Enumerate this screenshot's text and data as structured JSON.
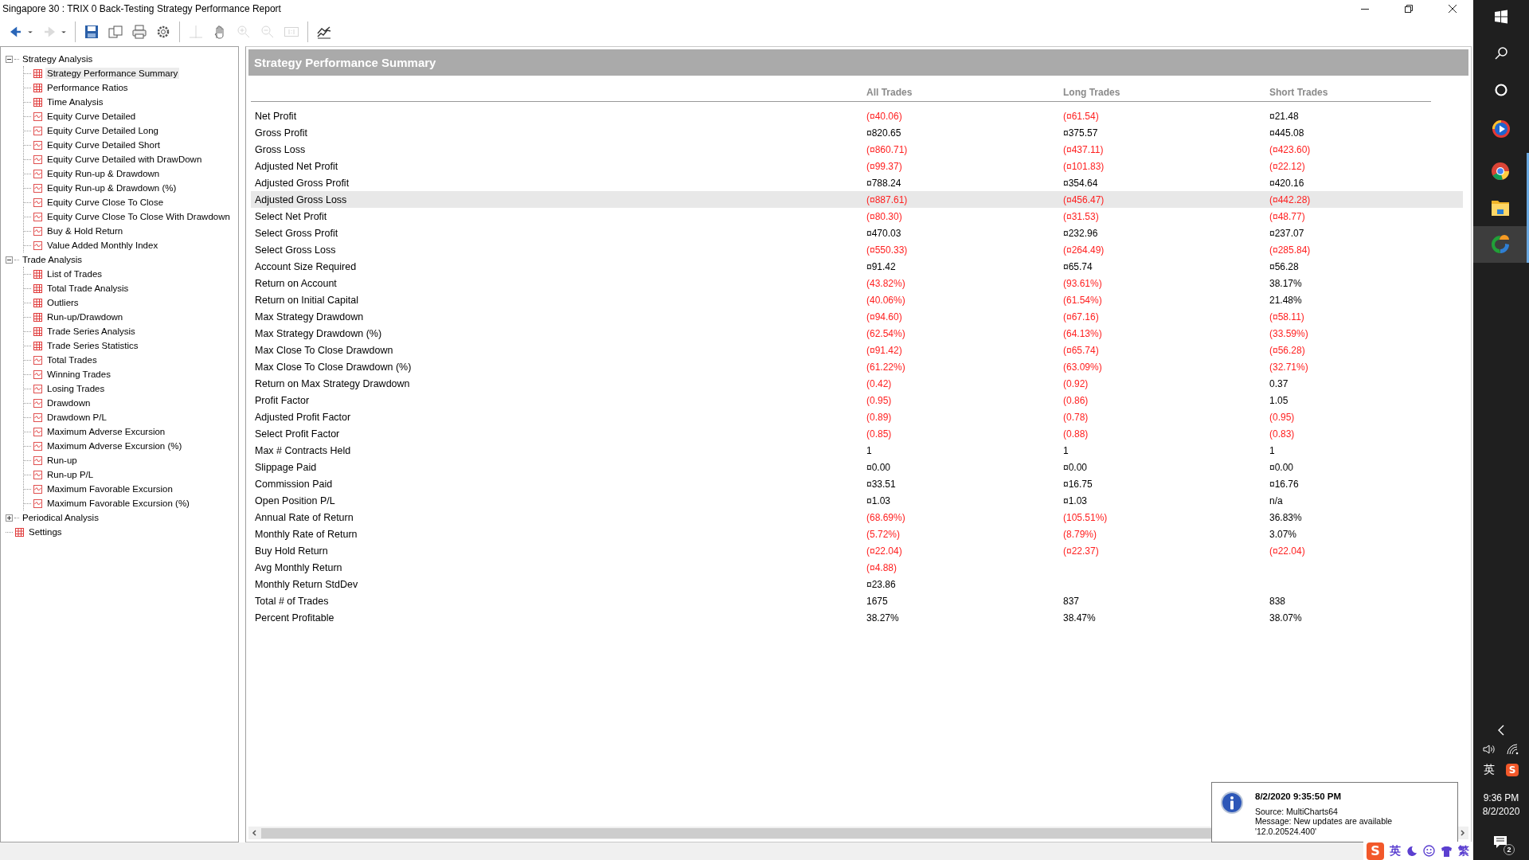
{
  "window": {
    "title": "Singapore 30 : TRIX 0 Back-Testing Strategy Performance Report"
  },
  "toolbar": [
    {
      "kind": "back",
      "disabled": false
    },
    {
      "kind": "caret",
      "disabled": false
    },
    {
      "kind": "forward",
      "disabled": true
    },
    {
      "kind": "caret",
      "disabled": false
    },
    {
      "kind": "sep"
    },
    {
      "kind": "save",
      "disabled": false
    },
    {
      "kind": "pages",
      "disabled": false
    },
    {
      "kind": "print",
      "disabled": false
    },
    {
      "kind": "gear",
      "disabled": false
    },
    {
      "kind": "sep"
    },
    {
      "kind": "cross",
      "disabled": true
    },
    {
      "kind": "hand",
      "disabled": false
    },
    {
      "kind": "zoomin",
      "disabled": true
    },
    {
      "kind": "zoomout",
      "disabled": true
    },
    {
      "kind": "fit",
      "disabled": true
    },
    {
      "kind": "sep"
    },
    {
      "kind": "chart",
      "disabled": false
    }
  ],
  "tree": [
    {
      "label": "Strategy Analysis",
      "kind": "group",
      "expanded": true,
      "selected": false,
      "children": [
        {
          "label": "Strategy Performance Summary",
          "kind": "table",
          "selected": true
        },
        {
          "label": "Performance Ratios",
          "kind": "table",
          "selected": false
        },
        {
          "label": "Time Analysis",
          "kind": "table",
          "selected": false
        },
        {
          "label": "Equity Curve Detailed",
          "kind": "chart",
          "selected": false
        },
        {
          "label": "Equity Curve Detailed Long",
          "kind": "chart",
          "selected": false
        },
        {
          "label": "Equity Curve Detailed Short",
          "kind": "chart",
          "selected": false
        },
        {
          "label": "Equity Curve Detailed with DrawDown",
          "kind": "chart",
          "selected": false
        },
        {
          "label": "Equity Run-up & Drawdown",
          "kind": "chart",
          "selected": false
        },
        {
          "label": "Equity Run-up & Drawdown (%)",
          "kind": "chart",
          "selected": false
        },
        {
          "label": "Equity Curve Close To Close",
          "kind": "chart",
          "selected": false
        },
        {
          "label": "Equity Curve Close To Close With Drawdown",
          "kind": "chart",
          "selected": false
        },
        {
          "label": "Buy & Hold Return",
          "kind": "chart",
          "selected": false
        },
        {
          "label": "Value Added Monthly Index",
          "kind": "chart",
          "selected": false
        }
      ]
    },
    {
      "label": "Trade Analysis",
      "kind": "group",
      "expanded": true,
      "selected": false,
      "children": [
        {
          "label": "List of Trades",
          "kind": "table",
          "selected": false
        },
        {
          "label": "Total Trade Analysis",
          "kind": "table",
          "selected": false
        },
        {
          "label": "Outliers",
          "kind": "table",
          "selected": false
        },
        {
          "label": "Run-up/Drawdown",
          "kind": "table",
          "selected": false
        },
        {
          "label": "Trade Series Analysis",
          "kind": "table",
          "selected": false
        },
        {
          "label": "Trade Series Statistics",
          "kind": "table",
          "selected": false
        },
        {
          "label": "Total Trades",
          "kind": "chart",
          "selected": false
        },
        {
          "label": "Winning Trades",
          "kind": "chart",
          "selected": false
        },
        {
          "label": "Losing Trades",
          "kind": "chart",
          "selected": false
        },
        {
          "label": "Drawdown",
          "kind": "chart",
          "selected": false
        },
        {
          "label": "Drawdown P/L",
          "kind": "chart",
          "selected": false
        },
        {
          "label": "Maximum Adverse Excursion",
          "kind": "chart",
          "selected": false
        },
        {
          "label": "Maximum Adverse Excursion (%)",
          "kind": "chart",
          "selected": false
        },
        {
          "label": "Run-up",
          "kind": "chart",
          "selected": false
        },
        {
          "label": "Run-up P/L",
          "kind": "chart",
          "selected": false
        },
        {
          "label": "Maximum Favorable Excursion",
          "kind": "chart",
          "selected": false
        },
        {
          "label": "Maximum Favorable Excursion (%)",
          "kind": "chart",
          "selected": false
        }
      ]
    },
    {
      "label": "Periodical Analysis",
      "kind": "group",
      "expanded": false,
      "selected": false
    },
    {
      "label": "Settings",
      "kind": "table",
      "selected": false
    }
  ],
  "report": {
    "title": "Strategy Performance Summary",
    "columns": [
      "All Trades",
      "Long Trades",
      "Short Trades"
    ],
    "rows": [
      {
        "label": "Net Profit",
        "selected": false,
        "values": [
          {
            "text": "(¤40.06)",
            "negative": true
          },
          {
            "text": "(¤61.54)",
            "negative": true
          },
          {
            "text": "¤21.48",
            "negative": false
          }
        ]
      },
      {
        "label": "Gross Profit",
        "selected": false,
        "values": [
          {
            "text": "¤820.65",
            "negative": false
          },
          {
            "text": "¤375.57",
            "negative": false
          },
          {
            "text": "¤445.08",
            "negative": false
          }
        ]
      },
      {
        "label": "Gross Loss",
        "selected": false,
        "values": [
          {
            "text": "(¤860.71)",
            "negative": true
          },
          {
            "text": "(¤437.11)",
            "negative": true
          },
          {
            "text": "(¤423.60)",
            "negative": true
          }
        ]
      },
      {
        "label": "Adjusted Net Profit",
        "selected": false,
        "values": [
          {
            "text": "(¤99.37)",
            "negative": true
          },
          {
            "text": "(¤101.83)",
            "negative": true
          },
          {
            "text": "(¤22.12)",
            "negative": true
          }
        ]
      },
      {
        "label": "Adjusted Gross Profit",
        "selected": false,
        "values": [
          {
            "text": "¤788.24",
            "negative": false
          },
          {
            "text": "¤354.64",
            "negative": false
          },
          {
            "text": "¤420.16",
            "negative": false
          }
        ]
      },
      {
        "label": "Adjusted Gross Loss",
        "selected": true,
        "values": [
          {
            "text": "(¤887.61)",
            "negative": true
          },
          {
            "text": "(¤456.47)",
            "negative": true
          },
          {
            "text": "(¤442.28)",
            "negative": true
          }
        ]
      },
      {
        "label": "Select Net Profit",
        "selected": false,
        "values": [
          {
            "text": "(¤80.30)",
            "negative": true
          },
          {
            "text": "(¤31.53)",
            "negative": true
          },
          {
            "text": "(¤48.77)",
            "negative": true
          }
        ]
      },
      {
        "label": "Select Gross Profit",
        "selected": false,
        "values": [
          {
            "text": "¤470.03",
            "negative": false
          },
          {
            "text": "¤232.96",
            "negative": false
          },
          {
            "text": "¤237.07",
            "negative": false
          }
        ]
      },
      {
        "label": "Select Gross Loss",
        "selected": false,
        "values": [
          {
            "text": "(¤550.33)",
            "negative": true
          },
          {
            "text": "(¤264.49)",
            "negative": true
          },
          {
            "text": "(¤285.84)",
            "negative": true
          }
        ]
      },
      {
        "label": "Account Size Required",
        "selected": false,
        "values": [
          {
            "text": "¤91.42",
            "negative": false
          },
          {
            "text": "¤65.74",
            "negative": false
          },
          {
            "text": "¤56.28",
            "negative": false
          }
        ]
      },
      {
        "label": "Return on Account",
        "selected": false,
        "values": [
          {
            "text": "(43.82%)",
            "negative": true
          },
          {
            "text": "(93.61%)",
            "negative": true
          },
          {
            "text": "38.17%",
            "negative": false
          }
        ]
      },
      {
        "label": "Return on Initial Capital",
        "selected": false,
        "values": [
          {
            "text": "(40.06%)",
            "negative": true
          },
          {
            "text": "(61.54%)",
            "negative": true
          },
          {
            "text": "21.48%",
            "negative": false
          }
        ]
      },
      {
        "label": "Max Strategy Drawdown",
        "selected": false,
        "values": [
          {
            "text": "(¤94.60)",
            "negative": true
          },
          {
            "text": "(¤67.16)",
            "negative": true
          },
          {
            "text": "(¤58.11)",
            "negative": true
          }
        ]
      },
      {
        "label": "Max Strategy Drawdown (%)",
        "selected": false,
        "values": [
          {
            "text": "(62.54%)",
            "negative": true
          },
          {
            "text": "(64.13%)",
            "negative": true
          },
          {
            "text": "(33.59%)",
            "negative": true
          }
        ]
      },
      {
        "label": "Max Close To Close Drawdown",
        "selected": false,
        "values": [
          {
            "text": "(¤91.42)",
            "negative": true
          },
          {
            "text": "(¤65.74)",
            "negative": true
          },
          {
            "text": "(¤56.28)",
            "negative": true
          }
        ]
      },
      {
        "label": "Max Close To Close Drawdown (%)",
        "selected": false,
        "values": [
          {
            "text": "(61.22%)",
            "negative": true
          },
          {
            "text": "(63.09%)",
            "negative": true
          },
          {
            "text": "(32.71%)",
            "negative": true
          }
        ]
      },
      {
        "label": "Return on Max Strategy Drawdown",
        "selected": false,
        "values": [
          {
            "text": "(0.42)",
            "negative": true
          },
          {
            "text": "(0.92)",
            "negative": true
          },
          {
            "text": "0.37",
            "negative": false
          }
        ]
      },
      {
        "label": "Profit Factor",
        "selected": false,
        "values": [
          {
            "text": "(0.95)",
            "negative": true
          },
          {
            "text": "(0.86)",
            "negative": true
          },
          {
            "text": "1.05",
            "negative": false
          }
        ]
      },
      {
        "label": "Adjusted Profit Factor",
        "selected": false,
        "values": [
          {
            "text": "(0.89)",
            "negative": true
          },
          {
            "text": "(0.78)",
            "negative": true
          },
          {
            "text": "(0.95)",
            "negative": true
          }
        ]
      },
      {
        "label": "Select Profit Factor",
        "selected": false,
        "values": [
          {
            "text": "(0.85)",
            "negative": true
          },
          {
            "text": "(0.88)",
            "negative": true
          },
          {
            "text": "(0.83)",
            "negative": true
          }
        ]
      },
      {
        "label": "Max # Contracts Held",
        "selected": false,
        "values": [
          {
            "text": "1",
            "negative": false
          },
          {
            "text": "1",
            "negative": false
          },
          {
            "text": "1",
            "negative": false
          }
        ]
      },
      {
        "label": "Slippage Paid",
        "selected": false,
        "values": [
          {
            "text": "¤0.00",
            "negative": false
          },
          {
            "text": "¤0.00",
            "negative": false
          },
          {
            "text": "¤0.00",
            "negative": false
          }
        ]
      },
      {
        "label": "Commission Paid",
        "selected": false,
        "values": [
          {
            "text": "¤33.51",
            "negative": false
          },
          {
            "text": "¤16.75",
            "negative": false
          },
          {
            "text": "¤16.76",
            "negative": false
          }
        ]
      },
      {
        "label": "Open Position P/L",
        "selected": false,
        "values": [
          {
            "text": "¤1.03",
            "negative": false
          },
          {
            "text": "¤1.03",
            "negative": false
          },
          {
            "text": "n/a",
            "negative": false
          }
        ]
      },
      {
        "label": "Annual Rate of Return",
        "selected": false,
        "values": [
          {
            "text": "(68.69%)",
            "negative": true
          },
          {
            "text": "(105.51%)",
            "negative": true
          },
          {
            "text": "36.83%",
            "negative": false
          }
        ]
      },
      {
        "label": "Monthly Rate of Return",
        "selected": false,
        "values": [
          {
            "text": "(5.72%)",
            "negative": true
          },
          {
            "text": "(8.79%)",
            "negative": true
          },
          {
            "text": "3.07%",
            "negative": false
          }
        ]
      },
      {
        "label": "Buy  Hold Return",
        "selected": false,
        "values": [
          {
            "text": "(¤22.04)",
            "negative": true
          },
          {
            "text": "(¤22.37)",
            "negative": true
          },
          {
            "text": "(¤22.04)",
            "negative": true
          }
        ]
      },
      {
        "label": "Avg Monthly Return",
        "selected": false,
        "values": [
          {
            "text": "(¤4.88)",
            "negative": true
          }
        ]
      },
      {
        "label": "Monthly Return StdDev",
        "selected": false,
        "values": [
          {
            "text": "¤23.86",
            "negative": false
          }
        ]
      },
      {
        "label": "Total # of Trades",
        "selected": false,
        "values": [
          {
            "text": "1675",
            "negative": false
          },
          {
            "text": "837",
            "negative": false
          },
          {
            "text": "838",
            "negative": false
          }
        ]
      },
      {
        "label": "Percent Profitable",
        "selected": false,
        "values": [
          {
            "text": "38.27%",
            "negative": false
          },
          {
            "text": "38.47%",
            "negative": false
          },
          {
            "text": "38.07%",
            "negative": false
          }
        ]
      }
    ]
  },
  "notification": {
    "time": "8/2/2020 9:35:50 PM",
    "source": "Source: MultiCharts64",
    "message": "Message: New updates are available",
    "detail": "'12.0.20524.400'"
  },
  "ime_bar": {
    "logo": "S",
    "mode": "英",
    "variant": "繁"
  },
  "taskbar": {
    "ime_mode": "英",
    "ime_logo": "S",
    "time": "9:36 PM",
    "date": "8/2/2020",
    "notifications": "2"
  }
}
